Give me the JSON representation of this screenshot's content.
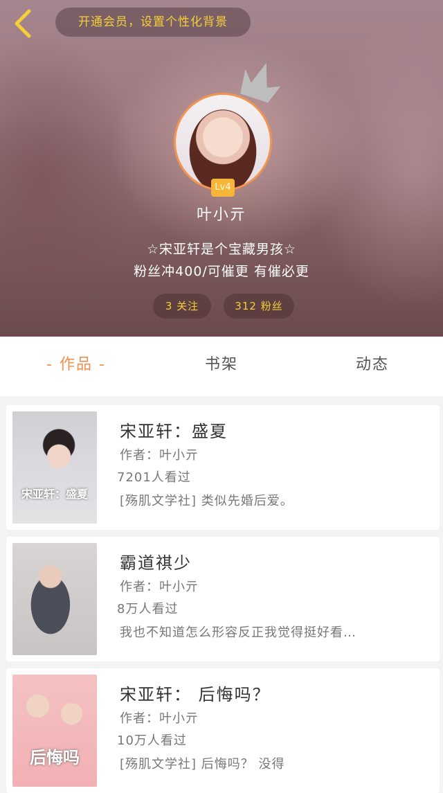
{
  "header": {
    "vip_banner": "开通会员，设置个性化背景",
    "level": "Lv4",
    "nickname": "叶小亓",
    "bio_line1": "☆宋亚轩是个宝藏男孩☆",
    "bio_line2": "粉丝冲400/可催更 有催必更",
    "following": "3 关注",
    "followers": "312 粉丝"
  },
  "tabs": [
    "- 作品 -",
    "书架",
    "动态"
  ],
  "works": [
    {
      "title": "宋亚轩：盛夏",
      "author": "作者：叶小亓",
      "views": "7201人看过",
      "desc": "[殇肌文学社] 类似先婚后爱。",
      "cover_text": "宋亚轩：盛夏"
    },
    {
      "title": "霸道祺少",
      "author": "作者：叶小亓",
      "views": "8万人看过",
      "desc": "我也不知道怎么形容反正我觉得挺好看…",
      "cover_text": ""
    },
    {
      "title": "宋亚轩： 后悔吗？",
      "author": "作者：叶小亓",
      "views": "10万人看过",
      "desc": "[殇肌文学社] 后悔吗？ 没得",
      "cover_text": "后悔吗"
    }
  ],
  "colors": {
    "accent": "#f0904c",
    "gold": "#f4cf3a",
    "level_badge": "#f5b63a"
  },
  "icons": {
    "back": "chevron-left-icon",
    "crown": "crown-icon"
  }
}
